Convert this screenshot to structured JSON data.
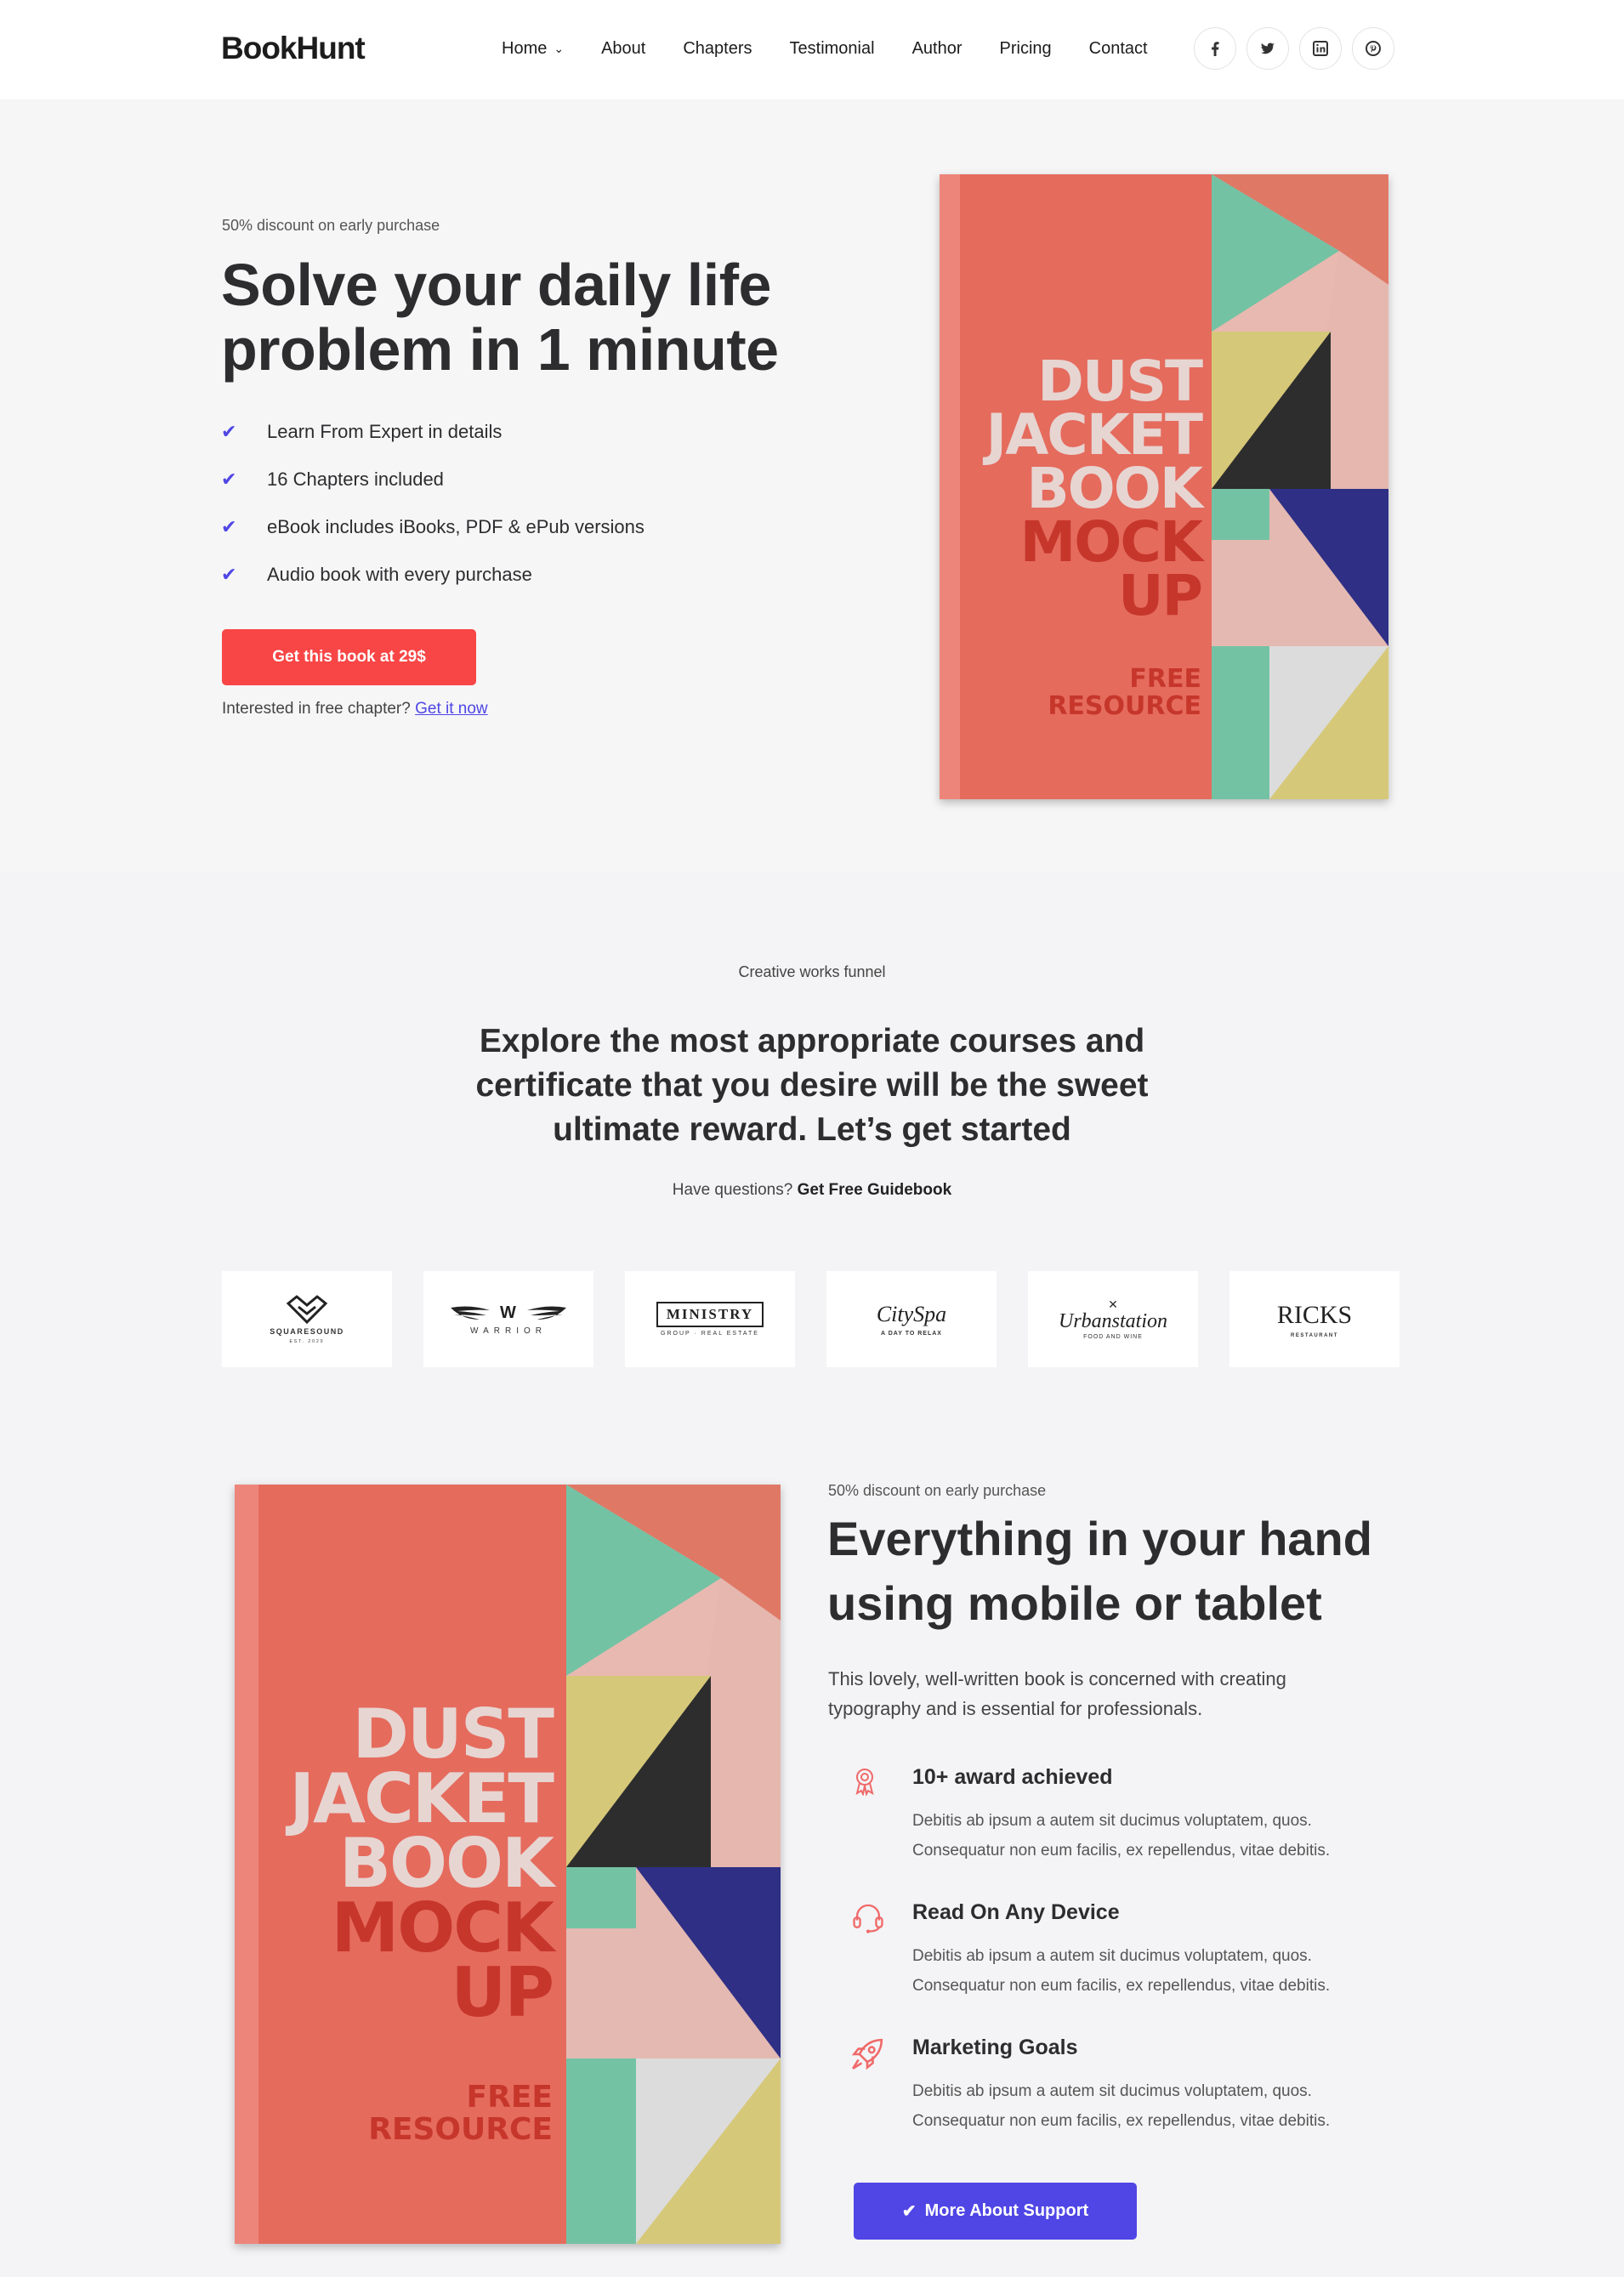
{
  "nav": {
    "logo": "BookHunt",
    "items": [
      {
        "label": "Home",
        "has_dropdown": true
      },
      {
        "label": "About"
      },
      {
        "label": "Chapters"
      },
      {
        "label": "Testimonial"
      },
      {
        "label": "Author"
      },
      {
        "label": "Pricing"
      },
      {
        "label": "Contact"
      }
    ],
    "socials": [
      "facebook-icon",
      "twitter-icon",
      "linkedin-icon",
      "pinterest-icon"
    ]
  },
  "hero": {
    "eyebrow": "50% discount on early purchase",
    "title": "Solve your daily life problem in 1 minute",
    "checklist": [
      "Learn From Expert in details",
      "16 Chapters included",
      "eBook includes iBooks, PDF & ePub versions",
      "Audio book with every purchase"
    ],
    "cta_label": "Get this book at 29$",
    "free_text": "Interested in free chapter?",
    "free_link": "Get it now"
  },
  "book_cover": {
    "line1": "DUST",
    "line2": "JACKET",
    "line3": "BOOK",
    "line4": "MOCK",
    "line5": "UP",
    "free1": "FREE",
    "free2": "RESOURCE"
  },
  "courses": {
    "eyebrow": "Creative works funnel",
    "title": "Explore the most appropriate courses and certificate that you desire will be the sweet ultimate reward. Let’s get started",
    "question": "Have questions?",
    "question_link": "Get Free Guidebook"
  },
  "partners": [
    {
      "name": "SQUARESOUND",
      "sub": "EST. 2020"
    },
    {
      "name": "W",
      "sub": "WARRIOR"
    },
    {
      "name": "MINISTRY",
      "sub": "GROUP · REAL ESTATE"
    },
    {
      "name": "CitySpa",
      "sub": "A DAY TO RELAX"
    },
    {
      "name": "Urbanstation",
      "sub": "FOOD AND WINE"
    },
    {
      "name": "RICKS",
      "sub": "RESTAURANT"
    }
  ],
  "feature_section": {
    "eyebrow": "50% discount on early purchase",
    "title": "Everything in your hand using mobile or tablet",
    "description": "This lovely, well-written book is concerned with creating typography and is essential for professionals.",
    "features": [
      {
        "icon": "award-icon",
        "title": "10+ award achieved",
        "text": "Debitis ab ipsum a autem sit ducimus voluptatem, quos. Consequatur non eum facilis, ex repellendus, vitae debitis."
      },
      {
        "icon": "headset-icon",
        "title": "Read On Any Device",
        "text": "Debitis ab ipsum a autem sit ducimus voluptatem, quos. Consequatur non eum facilis, ex repellendus, vitae debitis."
      },
      {
        "icon": "rocket-icon",
        "title": "Marketing Goals",
        "text": "Debitis ab ipsum a autem sit ducimus voluptatem, quos. Consequatur non eum facilis, ex repellendus, vitae debitis."
      }
    ],
    "support_label": "More About Support"
  },
  "colors": {
    "accent_red": "#f84545",
    "accent_blue": "#4f46e5",
    "icon_red": "#f06a6a"
  }
}
